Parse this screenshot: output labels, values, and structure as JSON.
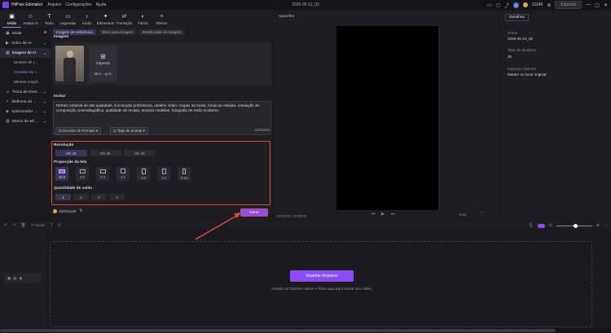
{
  "app": {
    "name": "HitPaw Edimakor",
    "menu": [
      "Arquivo",
      "Configurações",
      "Ajuda"
    ],
    "doc_title": "2026-05-12_02",
    "credits_count": "31140",
    "user_initial": "C",
    "export_label": "Exportar"
  },
  "toolbar": {
    "items": [
      {
        "label": "Mídia",
        "icon": "media-icon",
        "glyph": "▣"
      },
      {
        "label": "Avatar AI",
        "icon": "avatar-icon",
        "glyph": "☺"
      },
      {
        "label": "Texto",
        "icon": "text-icon",
        "glyph": "T"
      },
      {
        "label": "Legendas",
        "icon": "subtitles-icon",
        "glyph": "▭"
      },
      {
        "label": "Áudio",
        "icon": "audio-icon",
        "glyph": "♪"
      },
      {
        "label": "Elementos",
        "icon": "elements-icon",
        "glyph": "✦"
      },
      {
        "label": "Transição",
        "icon": "transition-icon",
        "glyph": "⇄"
      },
      {
        "label": "Filtros",
        "icon": "filters-icon",
        "glyph": "◐"
      },
      {
        "label": "Efeitos",
        "icon": "effects-icon",
        "glyph": "✧"
      }
    ]
  },
  "sidebar": {
    "items": [
      {
        "label": "Mídia",
        "glyph": "▣"
      },
      {
        "label": "Vídeo de IA",
        "glyph": "▶"
      },
      {
        "label": "Imagem de IA",
        "glyph": "▦"
      },
      {
        "label": "Troca de Rost...",
        "glyph": "☺"
      },
      {
        "label": "Melhoria de ...",
        "glyph": "✧"
      },
      {
        "label": "Aprimorador ...",
        "glyph": "◈"
      },
      {
        "label": "Banco de Mí...",
        "glyph": "▤"
      }
    ],
    "subitems": [
      "Modelo de I...",
      "Gerador de I...",
      "Minhas criaçõ..."
    ]
  },
  "panel": {
    "tabs": [
      "Imagem de referência",
      "Texto para imagem",
      "Restilizador de imagem"
    ],
    "image_section_label": "Imagem",
    "import_label": "Importar",
    "import_file": "Meu....gem",
    "prompt_label": "Incitar",
    "prompt_text": "Retrato editorial de alta qualidade, iluminação profissional, detalhe nítido, roupas da moda, fundo de estúdio, resolução 4K, composição cinematográfica, qualidade de revista, texturas realistas, fotografia de estilo moderno.",
    "prompt_generator": "Gerador de Prompts",
    "prompt_tags": "Tags de prompt",
    "char_count": "228/2000",
    "resolution_label": "Resolução",
    "resolutions": [
      "HD 1K",
      "HD 2K",
      "HD 4K"
    ],
    "aspect_label": "Proporção da tela",
    "aspects": [
      "16:9",
      "3:2",
      "4:3",
      "1:1",
      "3:4",
      "2:3",
      "9:16"
    ],
    "quantity_label": "Quantidade de saída",
    "quantities": [
      "1",
      "2",
      "3",
      "4"
    ],
    "credit_balance": "100/31140",
    "generate_label": "Gerar"
  },
  "preview": {
    "title": "Aparelho",
    "time": "00:00:00 | 00:00:00",
    "zoom": "9:16"
  },
  "details": {
    "tab": "Detalhes",
    "fields": [
      {
        "label": "Nome",
        "value": "2026-05-12_02"
      },
      {
        "label": "Taxa de Quadros",
        "value": "30"
      },
      {
        "label": "Importar material",
        "value": "Manter no local original"
      }
    ]
  },
  "timeline": {
    "split_label": "Dividir",
    "import_button": "Importar Arquivos",
    "hint": "Arraste ou importe vídeos e fotos aqui para iniciar seu vídeo."
  },
  "colors": {
    "accent": "#8a4cf3",
    "highlight": "#e04a3d",
    "background": "#1b1b1f"
  }
}
